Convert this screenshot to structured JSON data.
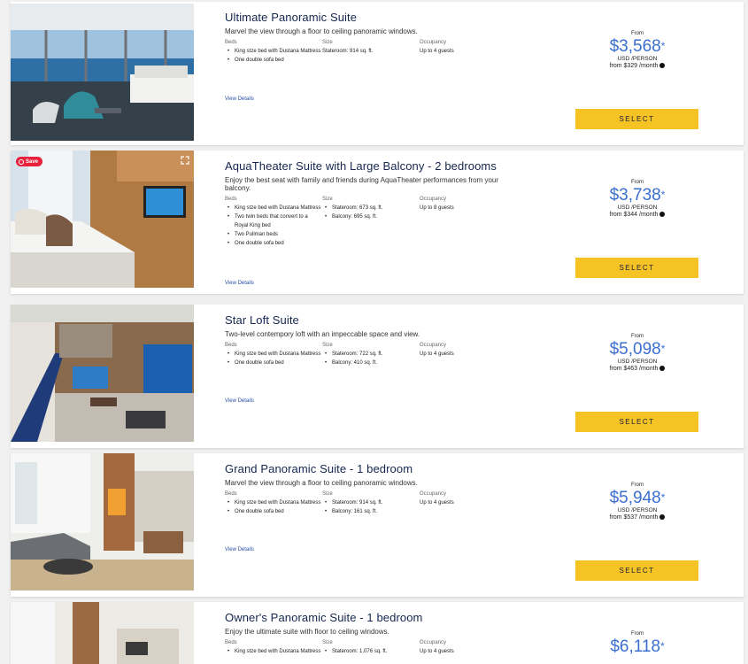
{
  "labels": {
    "beds": "Beds",
    "size": "Size",
    "occupancy": "Occupancy",
    "view_details": "View Details",
    "from": "From",
    "per_person": "USD /PERSON",
    "select": "SELECT",
    "save": "Save"
  },
  "suites": [
    {
      "title": "Ultimate Panoramic Suite",
      "description": "Marvel the view through a floor to ceiling panoramic windows.",
      "beds": [
        "King stze bed with Dustana Mattress",
        "One double sofa bed"
      ],
      "size": [
        "Stateroom: 914 sq. ft."
      ],
      "occupancy": "Up to 4 guests",
      "price": "$3,568",
      "monthly": "from $329 /month"
    },
    {
      "title": "AquaTheater Suite with Large Balcony - 2 bedrooms",
      "description": "Enjoy the best seat with family and friends during AquaTheater performances from your balcony.",
      "beds": [
        "King stze bed with Dustana Mattress",
        "Two twin beds that convert to a Royal King bed",
        "Two Pullman beds",
        "One double sofa bed"
      ],
      "size": [
        "Stateroom: 673 sq. ft.",
        "Balcony: 695 sq. ft."
      ],
      "occupancy": "Up to 8 guests",
      "price": "$3,738",
      "monthly": "from $344 /month"
    },
    {
      "title": "Star Loft Suite",
      "description": "Two-level contempory loft with an impeccable space and view.",
      "beds": [
        "King stze bed with Dustana Mattress",
        "One double sofa bed"
      ],
      "size": [
        "Stateroom: 722 sq. ft.",
        "Balcony: 410 sq. ft."
      ],
      "occupancy": "Up to 4 guests",
      "price": "$5,098",
      "monthly": "from $463 /month"
    },
    {
      "title": "Grand Panoramic Suite - 1 bedroom",
      "description": "Marvel the view through a floor to ceiling panoramic windows.",
      "beds": [
        "King stze bed with Dustana Mattress",
        "One double sofa bed"
      ],
      "size": [
        "Stateroom: 914 sq. ft.",
        "Balcony: 161 sq. ft."
      ],
      "occupancy": "Up to 4 guests",
      "price": "$5,948",
      "monthly": "from $537 /month"
    },
    {
      "title": "Owner's Panoramic Suite - 1 bedroom",
      "description": "Enjoy the ultimate suite with floor to ceiling windows.",
      "beds": [
        "King stze bed with Dustana Mattress"
      ],
      "size": [
        "Stateroom: 1,076 sq. ft."
      ],
      "occupancy": "Up to 4 guests",
      "price": "$6,118",
      "monthly": ""
    }
  ]
}
